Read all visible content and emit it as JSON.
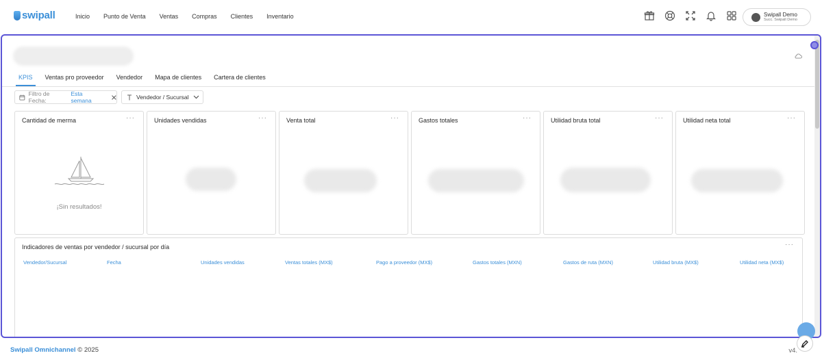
{
  "header": {
    "logo_text": "swipall",
    "nav": [
      "Inicio",
      "Punto de Venta",
      "Ventas",
      "Compras",
      "Clientes",
      "Inventario"
    ],
    "icons": [
      "gift-icon",
      "support-icon",
      "fullscreen-icon",
      "bell-icon",
      "apps-grid-icon"
    ],
    "user": {
      "name": "Swipall Demo",
      "branch": "Succ. Swipall Demo"
    }
  },
  "tabs": [
    "KPIS",
    "Ventas pro proveedor",
    "Vendedor",
    "Mapa de clientes",
    "Cartera de clientes"
  ],
  "filters": {
    "date_label": "Filtro de Fecha:",
    "date_value": "Esta semana",
    "group_label": "Vendedor / Sucursal"
  },
  "cards": [
    {
      "title": "Cantidad de merma",
      "empty_text": "¡Sin resultados!"
    },
    {
      "title": "Unidades vendidas"
    },
    {
      "title": "Venta total"
    },
    {
      "title": "Gastos totales"
    },
    {
      "title": "Utilidad bruta total"
    },
    {
      "title": "Utilidad neta total"
    }
  ],
  "menu_glyph": "···",
  "table": {
    "title": "Indicadores de ventas por vendedor / sucursal por día",
    "columns": [
      "Vendedor/Sucursal",
      "Fecha",
      "Unidades vendidas",
      "Ventas totales (MX$)",
      "Pago a proveedor (MX$)",
      "Gastos totales (MXN)",
      "Gastos de ruta (MXN)",
      "Utilidad bruta (MX$)",
      "Utilidad neta (MX$)"
    ]
  },
  "footer": {
    "brand": "Swipall Omnichannel",
    "copyright": "© 2025",
    "version": "v4."
  },
  "colors": {
    "accent": "#3b8fd8",
    "frame": "#5b55d6"
  }
}
